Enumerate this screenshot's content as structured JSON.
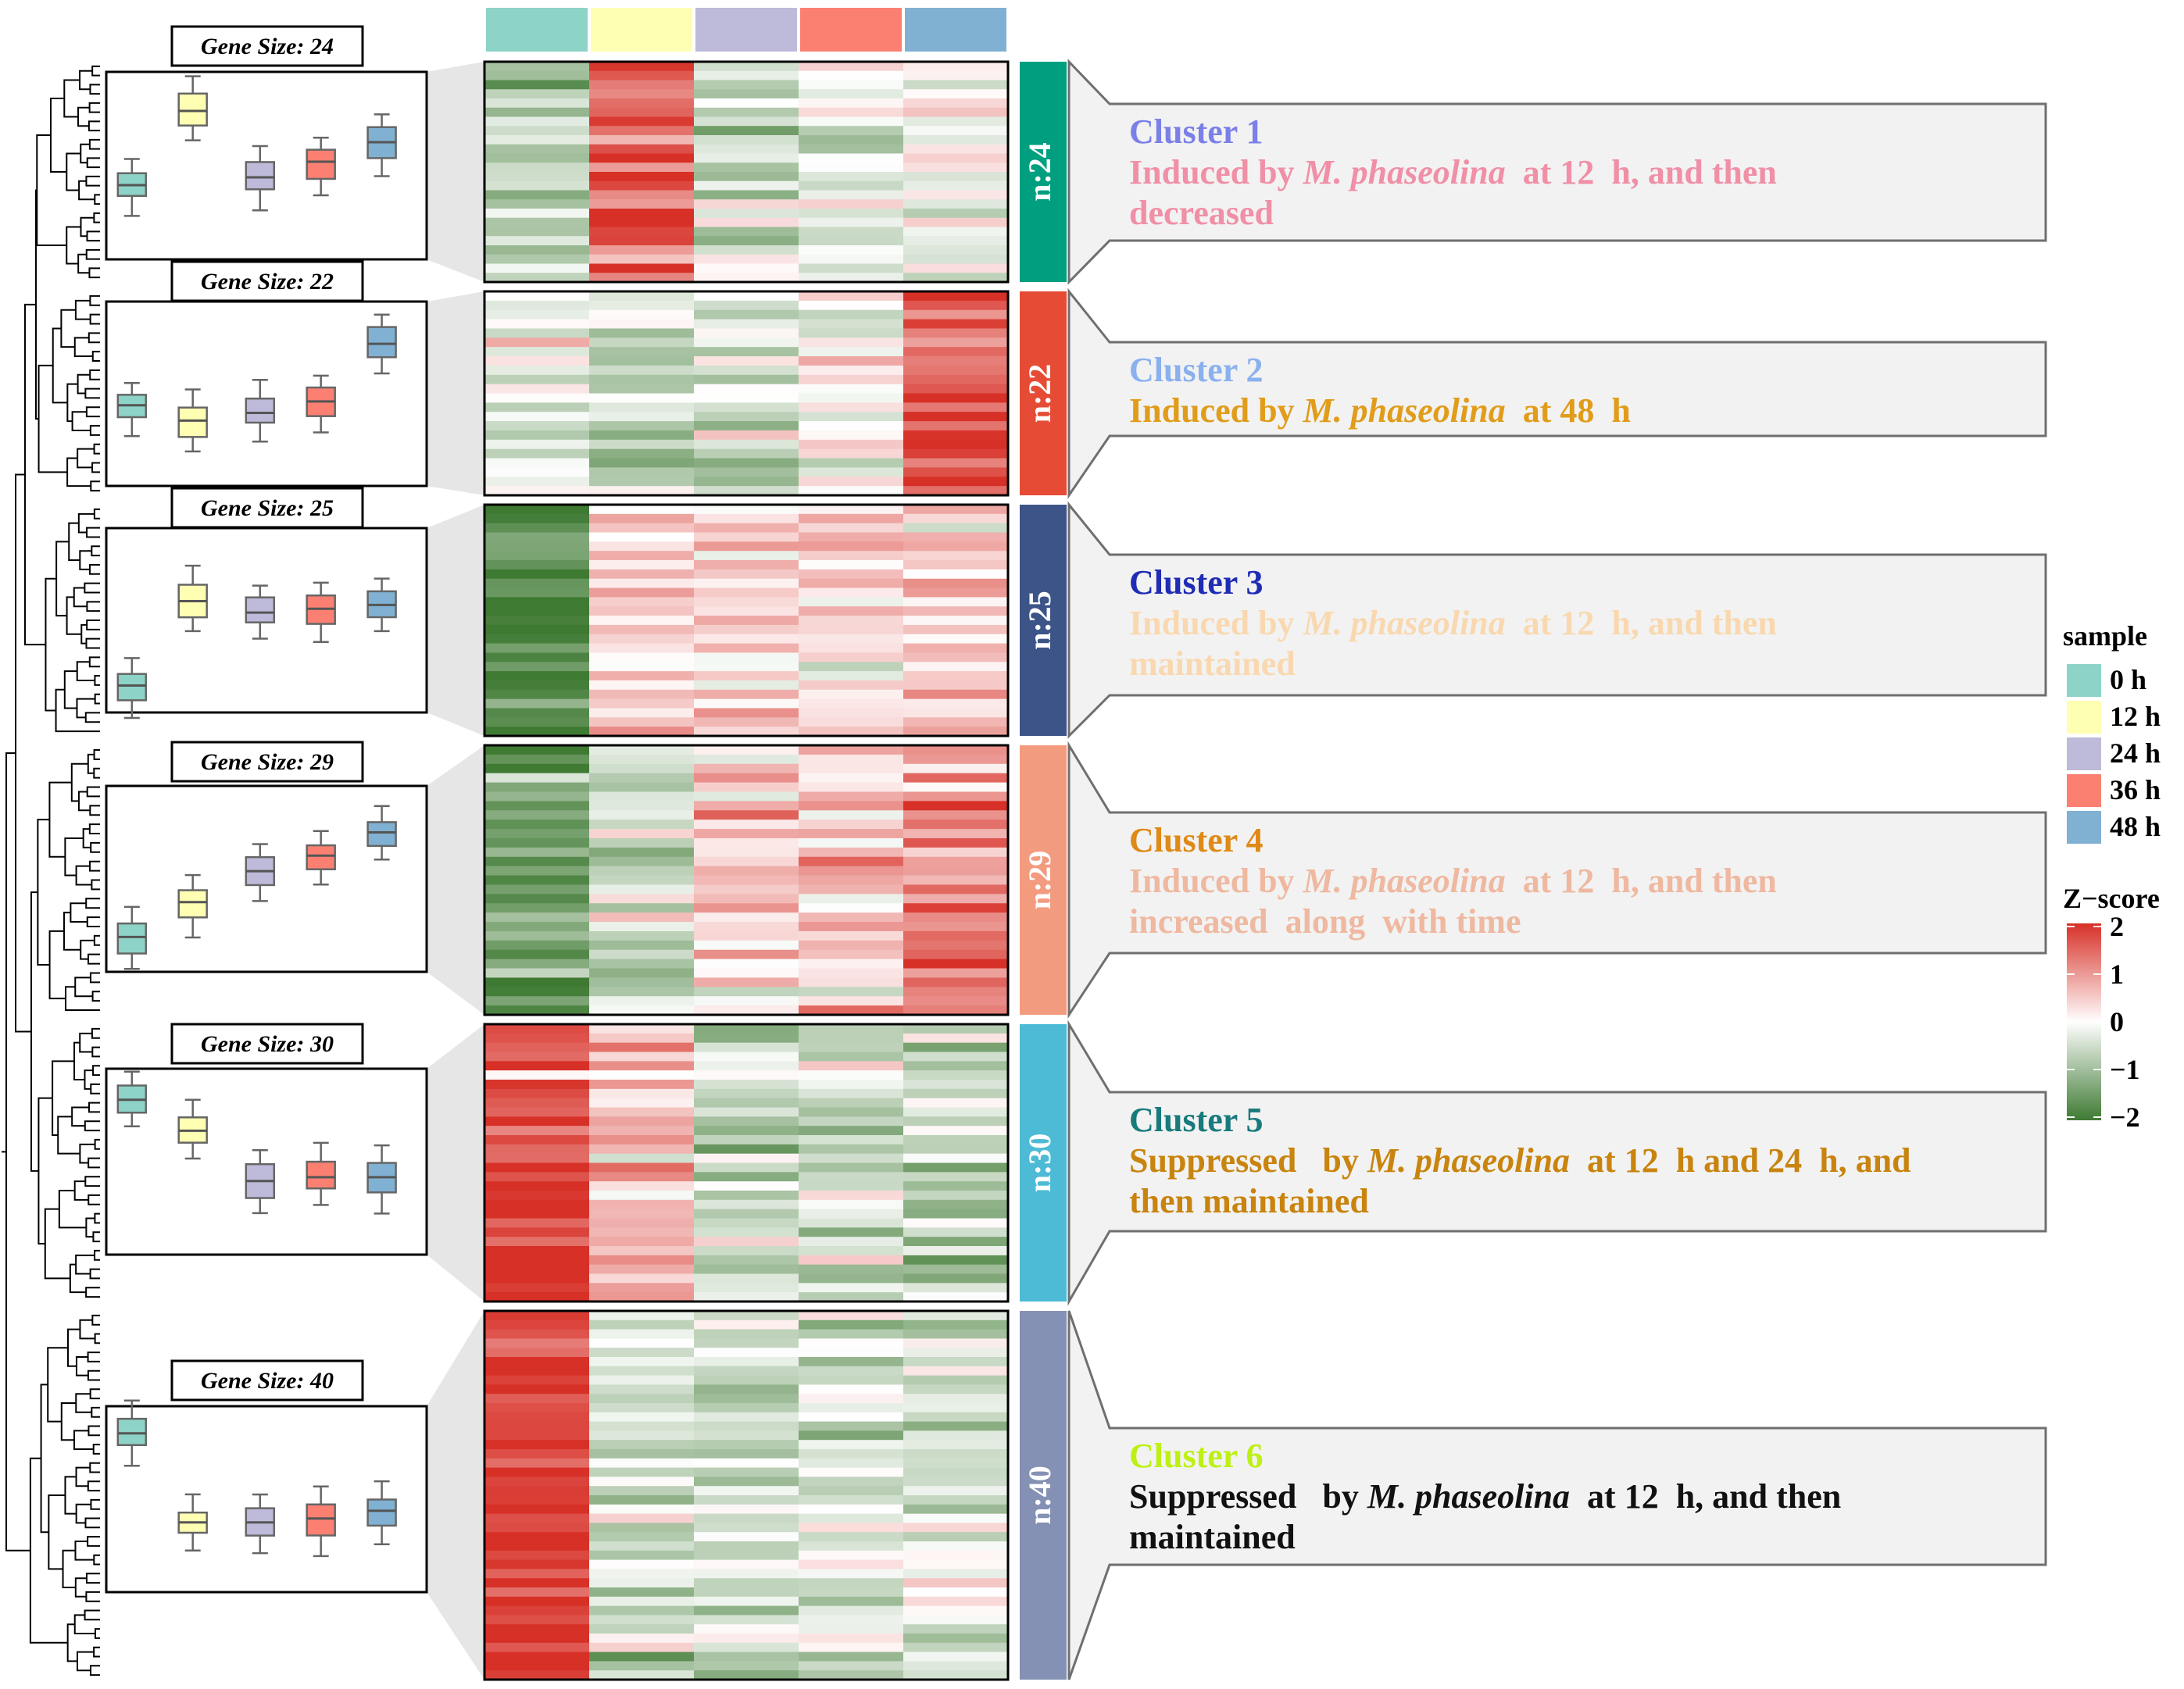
{
  "sample_legend": {
    "title": "sample",
    "items": [
      {
        "label": "0 h",
        "color": "#8dd3c7"
      },
      {
        "label": "12 h",
        "color": "#ffffb3"
      },
      {
        "label": "24 h",
        "color": "#bebada"
      },
      {
        "label": "36 h",
        "color": "#fb8072"
      },
      {
        "label": "48 h",
        "color": "#80b1d3"
      }
    ]
  },
  "zscore_legend": {
    "title": "Z−score",
    "ticks": [
      "2",
      "1",
      "0",
      "−1",
      "−2"
    ],
    "tick_values": [
      2,
      1,
      0,
      -1,
      -2
    ],
    "colors": {
      "high": "#d73027",
      "mid": "#ffffff",
      "low": "#3f7a33"
    }
  },
  "chart_data": {
    "type": "heatmap",
    "samples": [
      "0 h",
      "12 h",
      "24 h",
      "36 h",
      "48 h"
    ],
    "zscore_range": [
      -2,
      2
    ],
    "clusters": [
      {
        "name": "Cluster 1",
        "name_color": "#7b7fe8",
        "n_label": "n:24",
        "gene_size_label": "Gene Size: 24",
        "genes": 24,
        "band_color": "#009f7f",
        "desc": [
          [
            {
              "t": "Induced by ",
              "c": "#f08fa6"
            },
            {
              "t": "M. phaseolina",
              "c": "#f08fa6",
              "i": true
            },
            {
              "t": "  at 12  h, and then",
              "c": "#f08fa6"
            }
          ],
          [
            {
              "t": "decreased",
              "c": "#f08fa6"
            }
          ]
        ],
        "box_medians": [
          -0.5,
          1.4,
          -0.3,
          0.1,
          0.6
        ],
        "mean_z": [
          -0.8,
          1.5,
          -0.3,
          -0.2,
          0.0
        ]
      },
      {
        "name": "Cluster 2",
        "name_color": "#8ab0ee",
        "n_label": "n:22",
        "gene_size_label": "Gene Size: 22",
        "genes": 22,
        "band_color": "#e64b35",
        "desc": [
          [
            {
              "t": "Induced by ",
              "c": "#e09c1a"
            },
            {
              "t": "M. phaseolina",
              "c": "#e09c1a",
              "i": true
            },
            {
              "t": "  at 48  h",
              "c": "#e09c1a"
            }
          ]
        ],
        "box_medians": [
          -0.3,
          -0.7,
          -0.5,
          -0.2,
          1.3
        ],
        "mean_z": [
          -0.3,
          -0.7,
          -0.4,
          -0.1,
          1.5
        ]
      },
      {
        "name": "Cluster 3",
        "name_color": "#1f2cb5",
        "n_label": "n:25",
        "gene_size_label": "Gene Size: 25",
        "genes": 25,
        "band_color": "#3c5488",
        "desc": [
          [
            {
              "t": "Induced by ",
              "c": "#f9d8b0"
            },
            {
              "t": "M. phaseolina",
              "c": "#f9d8b0",
              "i": true
            },
            {
              "t": "  at 12  h, and then",
              "c": "#f9d8b0"
            }
          ],
          [
            {
              "t": "maintained",
              "c": "#f9d8b0"
            }
          ]
        ],
        "box_medians": [
          -1.7,
          0.5,
          0.2,
          0.3,
          0.4
        ],
        "mean_z": [
          -1.8,
          0.6,
          0.3,
          0.3,
          0.5
        ]
      },
      {
        "name": "Cluster 4",
        "name_color": "#df8a16",
        "n_label": "n:29",
        "gene_size_label": "Gene Size: 29",
        "genes": 29,
        "band_color": "#f39b7f",
        "desc": [
          [
            {
              "t": "Induced by ",
              "c": "#efb8a0"
            },
            {
              "t": "M. phaseolina",
              "c": "#efb8a0",
              "i": true
            },
            {
              "t": "  at 12  h, and then",
              "c": "#efb8a0"
            }
          ],
          [
            {
              "t": "increased  along  with time",
              "c": "#efb8a0"
            }
          ]
        ],
        "box_medians": [
          -1.5,
          -0.6,
          0.2,
          0.6,
          1.2
        ],
        "mean_z": [
          -1.4,
          -0.6,
          0.3,
          0.7,
          1.1
        ]
      },
      {
        "name": "Cluster 5",
        "name_color": "#187a7c",
        "n_label": "n:30",
        "gene_size_label": "Gene Size: 30",
        "genes": 30,
        "band_color": "#4dbbd5",
        "desc": [
          [
            {
              "t": "Suppressed   by ",
              "c": "#c8840e"
            },
            {
              "t": "M. phaseolina",
              "c": "#c8840e",
              "i": true
            },
            {
              "t": "  at 12  h and 24  h, and",
              "c": "#c8840e"
            }
          ],
          [
            {
              "t": "then maintained",
              "c": "#c8840e"
            }
          ]
        ],
        "box_medians": [
          1.6,
          0.8,
          -0.5,
          -0.4,
          -0.4
        ],
        "mean_z": [
          1.6,
          0.7,
          -0.6,
          -0.5,
          -0.5
        ]
      },
      {
        "name": "Cluster 6",
        "name_color": "#bdf013",
        "n_label": "n:40",
        "gene_size_label": "Gene Size: 40",
        "genes": 40,
        "band_color": "#8491b4",
        "desc": [
          [
            {
              "t": "Suppressed   by ",
              "c": "#111111"
            },
            {
              "t": "M. phaseolina",
              "c": "#111111",
              "i": true
            },
            {
              "t": "  at 12  h, and then",
              "c": "#111111"
            }
          ],
          [
            {
              "t": "maintained",
              "c": "#111111"
            }
          ]
        ],
        "box_medians": [
          1.7,
          -0.6,
          -0.6,
          -0.5,
          -0.3
        ],
        "mean_z": [
          1.8,
          -0.5,
          -0.5,
          -0.4,
          -0.3
        ]
      }
    ]
  }
}
